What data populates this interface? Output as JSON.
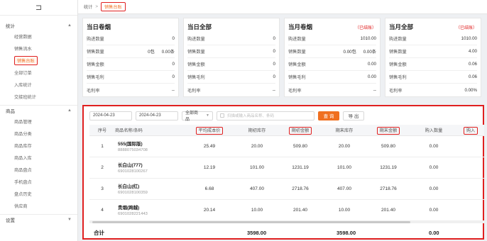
{
  "sidebar": {
    "collapse_glyph": "⊐",
    "sections": [
      {
        "label": "统计",
        "items": [
          "经营数据",
          "销售流水",
          "销售台账",
          "全部订单",
          "入库统计",
          "交接班统计"
        ]
      },
      {
        "label": "商品",
        "items": [
          "商品管理",
          "商品分类",
          "商品库存",
          "商品入库",
          "商品盘点",
          "手机盘点",
          "盘点历史",
          "供应商"
        ]
      },
      {
        "label": "设置",
        "items": []
      }
    ],
    "active_item": "销售台账"
  },
  "breadcrumb": {
    "parent": "统计",
    "separator": ">",
    "current": "销售台账"
  },
  "cards": [
    {
      "title": "当日卷烟",
      "tag": "",
      "rows": [
        {
          "label": "购进数量",
          "value": "0",
          "extra": ""
        },
        {
          "label": "销售数量",
          "value": "0.00条",
          "extra": "0包"
        },
        {
          "label": "销售金额",
          "value": "0",
          "extra": ""
        },
        {
          "label": "销售毛利",
          "value": "0",
          "extra": ""
        },
        {
          "label": "毛利率",
          "value": "--",
          "extra": ""
        }
      ]
    },
    {
      "title": "当日全部",
      "tag": "",
      "rows": [
        {
          "label": "购进数量",
          "value": "0",
          "extra": ""
        },
        {
          "label": "销售数量",
          "value": "0",
          "extra": ""
        },
        {
          "label": "销售金额",
          "value": "0",
          "extra": ""
        },
        {
          "label": "销售毛利",
          "value": "0",
          "extra": ""
        },
        {
          "label": "毛利率",
          "value": "--",
          "extra": ""
        }
      ]
    },
    {
      "title": "当月卷烟",
      "tag": "（已结账）",
      "rows": [
        {
          "label": "购进数量",
          "value": "1010.00",
          "extra": ""
        },
        {
          "label": "销售数量",
          "value": "0.00条",
          "extra": "0.00包"
        },
        {
          "label": "销售金额",
          "value": "0.00",
          "extra": ""
        },
        {
          "label": "销售毛利",
          "value": "0.00",
          "extra": ""
        },
        {
          "label": "毛利率",
          "value": "--",
          "extra": ""
        }
      ]
    },
    {
      "title": "当月全部",
      "tag": "（已结账）",
      "rows": [
        {
          "label": "购进数量",
          "value": "1010.00",
          "extra": ""
        },
        {
          "label": "销售数量",
          "value": "4.00",
          "extra": ""
        },
        {
          "label": "销售金额",
          "value": "0.06",
          "extra": ""
        },
        {
          "label": "销售毛利",
          "value": "0.06",
          "extra": ""
        },
        {
          "label": "毛利率",
          "value": "0.00%",
          "extra": ""
        }
      ]
    }
  ],
  "filters": {
    "start_date": "2024-04-23",
    "end_date": "2024-04-23",
    "category": "全部商品",
    "search_placeholder": "扫描或输入商品名称、条码",
    "query_label": "查 询",
    "export_label": "导 出"
  },
  "table": {
    "columns": [
      "序号",
      "商品名称/条码",
      "平均成本价",
      "期初库存",
      "期初金额",
      "期末库存",
      "期末金额",
      "购入数量",
      "购入"
    ],
    "highlighted_columns": [
      2,
      4,
      6,
      8
    ],
    "rows": [
      {
        "idx": "1",
        "name": "555(国际版)",
        "barcode": "8888075034708",
        "avg_cost": "25.49",
        "open_stock": "20.00",
        "open_amt": "509.80",
        "close_stock": "20.00",
        "close_amt": "509.80",
        "in_qty": "0.00"
      },
      {
        "idx": "2",
        "name": "长白山(777)",
        "barcode": "6901028100267",
        "avg_cost": "12.19",
        "open_stock": "101.00",
        "open_amt": "1231.19",
        "close_stock": "101.00",
        "close_amt": "1231.19",
        "in_qty": "0.00"
      },
      {
        "idx": "3",
        "name": "长白山(红)",
        "barcode": "6901028100359",
        "avg_cost": "6.68",
        "open_stock": "407.00",
        "open_amt": "2718.76",
        "close_stock": "407.00",
        "close_amt": "2718.76",
        "in_qty": "0.00"
      },
      {
        "idx": "4",
        "name": "贵烟(跨越)",
        "barcode": "6901028221443",
        "avg_cost": "20.14",
        "open_stock": "10.00",
        "open_amt": "201.40",
        "close_stock": "10.00",
        "close_amt": "201.40",
        "in_qty": "0.00"
      }
    ]
  },
  "totals": {
    "label": "合计",
    "open_amt": "3598.00",
    "close_amt": "3598.00",
    "in_qty": "0.00"
  },
  "colors": {
    "accent": "#f07020",
    "highlight": "#e02020"
  }
}
